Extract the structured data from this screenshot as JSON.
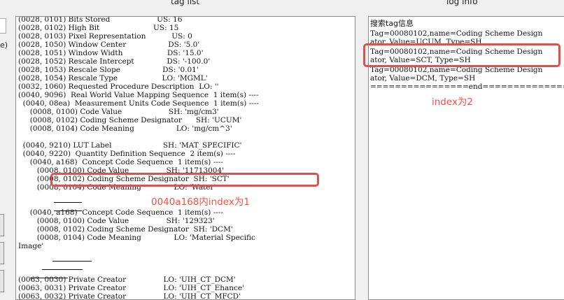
{
  "header": {
    "tag_list_title": "tag list",
    "log_info_title": "log info"
  },
  "left_stub": {
    "glyph": "e)"
  },
  "tag_list": {
    "lines": [
      "(0028, 0101) Bits Stored                    US: 16",
      "(0028, 0102) High Bit                       US: 15",
      "(0028, 0103) Pixel Representation           US: 0",
      "(0028, 1050) Window Center                  DS: '5.0'",
      "(0028, 1051) Window Width                   DS: '15.0'",
      "(0028, 1052) Rescale Intercept              DS: '-100.0'",
      "(0028, 1053) Rescale Slope                  DS: '0.01'",
      "(0028, 1054) Rescale Type                   LO: 'MGML'",
      "(0032, 1060) Requested Procedure Description  LO: ''",
      "(0040, 9096)  Real World Value Mapping Sequence  1 item(s) ----",
      "  (0040, 08ea)  Measurement Units Code Sequence  1 item(s) ----",
      "     (0008, 0100) Code Value                    SH: 'mg/cm3'",
      "     (0008, 0102) Coding Scheme Designator      SH: 'UCUM'",
      "     (0008, 0104) Code Meaning                  LO: 'mg/cm^3'",
      "",
      "  (0040, 9210) LUT Label                      SH: 'MAT_SPECIFIC'",
      "  (0040, 9220)  Quantity Definition Sequence  2 item(s) ----",
      "     (0040, a168)  Concept Code Sequence  1 item(s) ----",
      "        (0008, 0100) Code Value                SH: '11713004'",
      "        (0008, 0102) Coding Scheme Designator  SH: 'SCT'",
      "        (0008, 0104) Code Meaning              LO: 'Water'",
      "",
      "",
      "     (0040, a168)  Concept Code Sequence  1 item(s) ----",
      "        (0008, 0100) Code Value                SH: '129323'",
      "        (0008, 0102) Coding Scheme Designator  SH: 'DCM'",
      "        (0008, 0104) Code Meaning              LO: 'Material Specific",
      "Image'",
      "",
      "",
      "",
      "(0063, 0030) Private Creator                LO: 'UIH_CT_DCM'",
      "(0063, 0031) Private Creator                LO: 'UIH_CT_Ehance'",
      "(0063, 0032) Private Creator                LO: 'UIH_CT_MFCD'"
    ],
    "annotation": "0040a168内index为1"
  },
  "log_info": {
    "lines": [
      "搜索tag信息",
      "Tag=00080102,name=Coding Scheme Design",
      "ator, Value=UCUM, Type=SH",
      "Tag=00080102,name=Coding Scheme Design",
      "ator, Value=SCT, Type=SH",
      "Tag=00080102,name=Coding Scheme Design",
      "ator, Value=DCM, Type=SH",
      "================end================"
    ],
    "annotation": "index为2"
  },
  "colors": {
    "highlight": "#e05050",
    "annotation": "#ff4d3f"
  }
}
